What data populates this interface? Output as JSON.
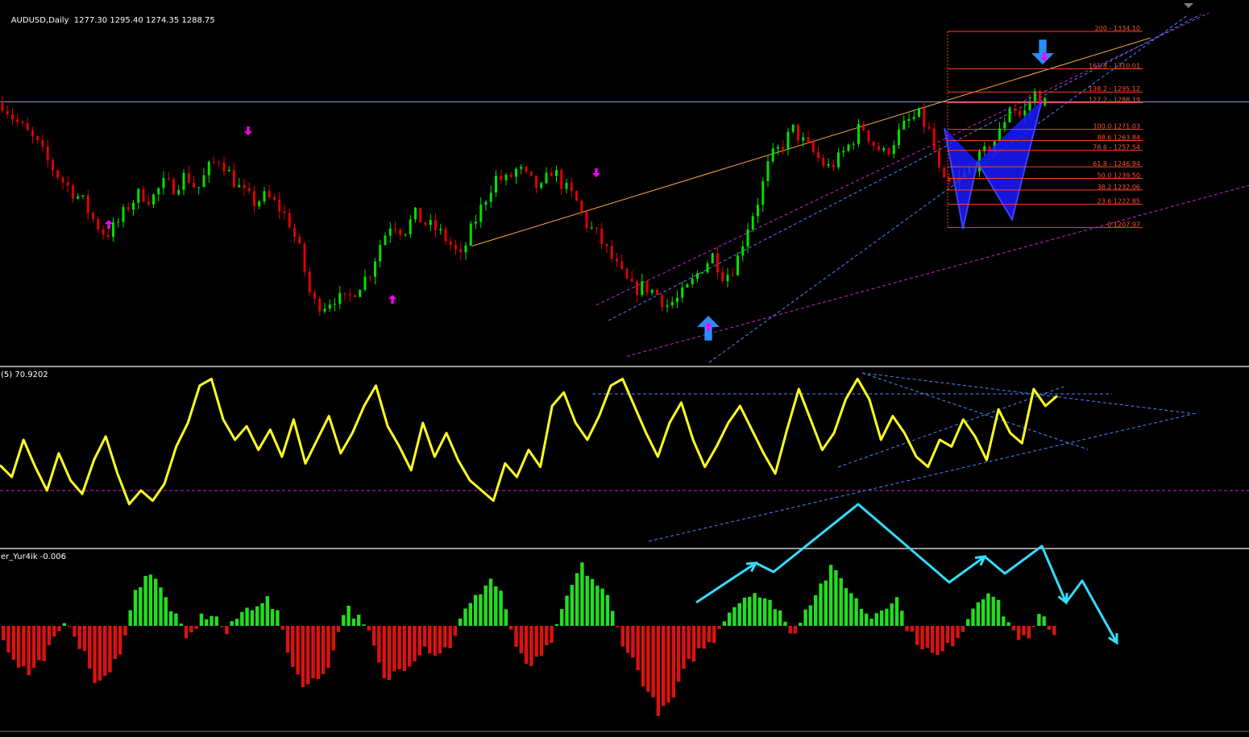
{
  "main_pane": {
    "symbol_label": "AUDUSD,Daily",
    "ohlc": "1277.30 1295.40 1274.35 1288.75"
  },
  "osc_pane": {
    "label": "(5) 70.9202"
  },
  "hist_pane": {
    "label": "er_Yur4ik -0.006"
  },
  "colors": {
    "background": "#000000",
    "bull_candle": "#00e000",
    "bear_candle": "#e00000",
    "price_line": "#8899cc",
    "fib_line": "#ff4020",
    "fib_text": "#ff5030",
    "oscillator": "#ffff20",
    "hist_up": "#22dd22",
    "hist_down": "#dd1111",
    "arrow_magenta": "#ff00ff",
    "arrow_blue": "#2a8cff",
    "channel_blue": "#4488ff",
    "channel_magenta": "#cc22cc",
    "trend_orange": "#ffaa44",
    "zigzag_cyan": "#33ddff",
    "harmonic_fill": "#1a1aff"
  },
  "fib_levels": [
    {
      "label": "200 - 1334.10"
    },
    {
      "label": "161.8 - 1310.01"
    },
    {
      "label": "138.2 - 1295.12"
    },
    {
      "label": "127.2 - 1288.19"
    },
    {
      "label": "100.0 1271.03"
    },
    {
      "label": "88.6 1263.84"
    },
    {
      "label": "78.6 - 1257.54"
    },
    {
      "label": "61.8 - 1246.94"
    },
    {
      "label": "50.0 1239.50"
    },
    {
      "label": "38.2 1232.06"
    },
    {
      "label": "23.6 1222.85"
    },
    {
      "label": "0 1207.97"
    }
  ],
  "chart_data": [
    {
      "type": "candlestick",
      "title": "AUDUSD,Daily",
      "ohlc_last": {
        "open": 1277.3,
        "high": 1295.4,
        "low": 1274.35,
        "close": 1288.75
      },
      "current_price": 1288.75,
      "close_series": [
        1288,
        1278,
        1270,
        1262,
        1250,
        1240,
        1232,
        1225,
        1212,
        1203,
        1210,
        1222,
        1230,
        1226,
        1236,
        1234,
        1242,
        1232,
        1246,
        1253,
        1240,
        1230,
        1224,
        1228,
        1222,
        1212,
        1192,
        1160,
        1158,
        1163,
        1160,
        1170,
        1178,
        1198,
        1212,
        1205,
        1216,
        1210,
        1206,
        1198,
        1188,
        1208,
        1224,
        1240,
        1238,
        1246,
        1238,
        1232,
        1246,
        1234,
        1226,
        1210,
        1202,
        1190,
        1178,
        1168,
        1170,
        1166,
        1158,
        1162,
        1170,
        1182,
        1190,
        1176,
        1184,
        1208,
        1226,
        1252,
        1260,
        1271,
        1262,
        1254,
        1246,
        1252,
        1262,
        1274,
        1262,
        1255,
        1266,
        1276,
        1280,
        1268,
        1236,
        1234,
        1242,
        1250,
        1258,
        1268,
        1288,
        1278,
        1295,
        1288
      ],
      "fibonacci": [
        {
          "level": 200,
          "price": 1334.1
        },
        {
          "level": 161.8,
          "price": 1310.01
        },
        {
          "level": 138.2,
          "price": 1295.12
        },
        {
          "level": 127.2,
          "price": 1288.19
        },
        {
          "level": 100.0,
          "price": 1271.03
        },
        {
          "level": 88.6,
          "price": 1263.84
        },
        {
          "level": 78.6,
          "price": 1257.54
        },
        {
          "level": 61.8,
          "price": 1246.94
        },
        {
          "level": 50.0,
          "price": 1239.5
        },
        {
          "level": 38.2,
          "price": 1232.06
        },
        {
          "level": 23.6,
          "price": 1222.85
        },
        {
          "level": 0,
          "price": 1207.97
        }
      ]
    },
    {
      "type": "line",
      "label": "(5) 70.9202",
      "last_value": 70.9202,
      "values": [
        45,
        38,
        60,
        44,
        30,
        52,
        36,
        28,
        48,
        62,
        40,
        22,
        30,
        24,
        34,
        56,
        70,
        92,
        96,
        72,
        60,
        68,
        54,
        66,
        50,
        72,
        46,
        60,
        74,
        52,
        64,
        80,
        92,
        68,
        56,
        42,
        70,
        50,
        64,
        48,
        36,
        30,
        24,
        46,
        38,
        54,
        44,
        80,
        88,
        70,
        60,
        74,
        92,
        96,
        80,
        64,
        50,
        70,
        82,
        60,
        44,
        56,
        70,
        80,
        66,
        52,
        40,
        66,
        90,
        72,
        54,
        64,
        84,
        96,
        84,
        60,
        74,
        64,
        50,
        44,
        60,
        56,
        72,
        62,
        48,
        78,
        64,
        58,
        90,
        80,
        86
      ]
    },
    {
      "type": "bar",
      "label": "er_Yur4ik -0.006",
      "last_value": -0.006,
      "values": [
        -0.4,
        -0.9,
        -1.2,
        -0.8,
        -0.3,
        0.1,
        -0.6,
        -1.4,
        -1.3,
        -0.5,
        0.8,
        1.4,
        0.9,
        0.3,
        -0.4,
        0.2,
        0.3,
        -0.2,
        0.3,
        0.5,
        0.7,
        0.2,
        -1.0,
        -1.5,
        -1.3,
        -0.8,
        0.5,
        0.2,
        -0.3,
        -1.4,
        -1.1,
        -0.9,
        -0.5,
        -0.7,
        -0.5,
        0.3,
        0.7,
        1.2,
        0.8,
        -0.6,
        -1.0,
        -0.8,
        -0.2,
        0.8,
        1.5,
        1.1,
        0.7,
        -0.3,
        -0.9,
        -1.6,
        -2.2,
        -1.8,
        -1.0,
        -0.6,
        -0.4,
        0.3,
        0.6,
        0.9,
        0.6,
        0.5,
        -0.3,
        0.4,
        0.9,
        1.4,
        1.1,
        0.6,
        0.2,
        0.5,
        0.7,
        -0.2,
        -0.5,
        -0.8,
        -0.5,
        -0.1,
        0.6,
        0.9,
        0.4,
        -0.2,
        -0.4,
        0.3,
        -0.2
      ]
    }
  ]
}
